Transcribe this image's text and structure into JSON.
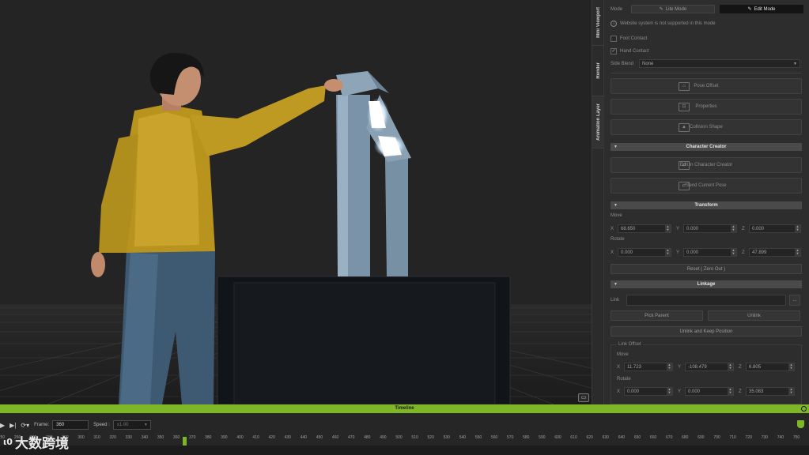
{
  "vtabs": [
    "Mini Viewport",
    "Render",
    "Animation Layer"
  ],
  "panel": {
    "mode_label": "Mode",
    "lite_mode": "Lite Mode",
    "edit_mode": "Edit Mode",
    "warning": "Website system is not supported in this mode",
    "foot_contact": "Foot Contact",
    "hand_contact": "Hand Contact",
    "side_blend_label": "Side Blend",
    "side_blend_value": "None",
    "pose_offset": "Pose Offset",
    "properties": "Properties",
    "collision_shape": "Collision Shape",
    "section_cc": "Character Creator",
    "edit_in_cc": "Edit in Character Creator",
    "send_current_pose": "Send Current Pose",
    "section_transform": "Transform",
    "move_label": "Move",
    "move": {
      "x": "68.650",
      "y": "0.000",
      "z": "0.000"
    },
    "rotate_label": "Rotate",
    "rotate": {
      "x": "0.000",
      "y": "0.000",
      "z": "47.899"
    },
    "reset_zero_out": "Reset ( Zero Out )",
    "section_linkage": "Linkage",
    "link_label": "Link",
    "link_value": "",
    "link_more": "...",
    "pick_parent": "Pick Parent",
    "unlink": "Unlink",
    "unlink_keep_position": "Unlink and Keep Position",
    "link_offset_label": "Link Offset",
    "lo_move_label": "Move",
    "lo_move": {
      "x": "11.723",
      "y": "-108.479",
      "z": "6.805"
    },
    "lo_rotate_label": "Rotate",
    "lo_rotate": {
      "x": "0.000",
      "y": "0.000",
      "z": "35.083"
    }
  },
  "timeline": {
    "title": "Timeline",
    "frame_label": "Frame:",
    "frame_value": "360",
    "speed_label": "Speed :",
    "speed_value": "x1.00",
    "ruler": [
      "250",
      "260",
      "270",
      "280",
      "290",
      "300",
      "310",
      "320",
      "330",
      "340",
      "350",
      "360",
      "370",
      "380",
      "390",
      "400",
      "410",
      "420",
      "430",
      "440",
      "450",
      "460",
      "470",
      "480",
      "490",
      "500",
      "510",
      "520",
      "530",
      "540",
      "550",
      "560",
      "570",
      "580",
      "590",
      "600",
      "610",
      "620",
      "630",
      "640",
      "650",
      "660",
      "670",
      "680",
      "690",
      "700",
      "710",
      "720",
      "730",
      "740",
      "750"
    ],
    "current_frame": 360
  },
  "watermark": {
    "mark": "ι0",
    "text": "大数跨境"
  },
  "colors": {
    "accent": "#7fb628",
    "panel": "#2d2d2d",
    "viewport": "#242424"
  }
}
